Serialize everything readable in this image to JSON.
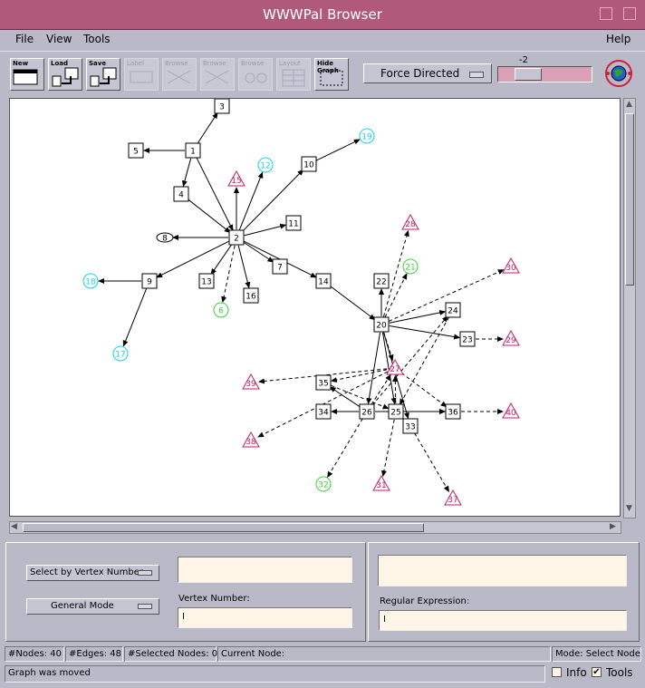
{
  "window": {
    "title": "WWWPal Browser"
  },
  "menus": {
    "file": "File",
    "view": "View",
    "tools": "Tools",
    "help": "Help"
  },
  "toolbar": {
    "new": "New",
    "load": "Load",
    "save": "Save",
    "disabled1": "Label",
    "disabled2": "Browse",
    "disabled3": "Browse",
    "disabled4": "Browse",
    "disabled5": "Layout",
    "hide_graph": "Hide Graph",
    "layout_value": "Force Directed",
    "zoom_value": "-2"
  },
  "graph": {
    "node_colors": {
      "box": "#000000",
      "cyan": "#19d0e8",
      "green": "#3bd23b",
      "magenta": "#c4196d"
    }
  },
  "bottom": {
    "select_mode": "Select by Vertex Number",
    "mode": "General Mode",
    "vertex_label": "Vertex Number:",
    "regex_label": "Regular Expression:",
    "vertex_value": "",
    "regex_value": ""
  },
  "status": {
    "nodes": "#Nodes: 40",
    "edges": "#Edges: 48",
    "selected": "#Selected Nodes: 0",
    "current": "Current Node:",
    "mode": "Mode: Select Node",
    "message": "Graph was moved",
    "info": "Info",
    "tools": "Tools",
    "info_checked": "",
    "tools_checked": "✔"
  }
}
